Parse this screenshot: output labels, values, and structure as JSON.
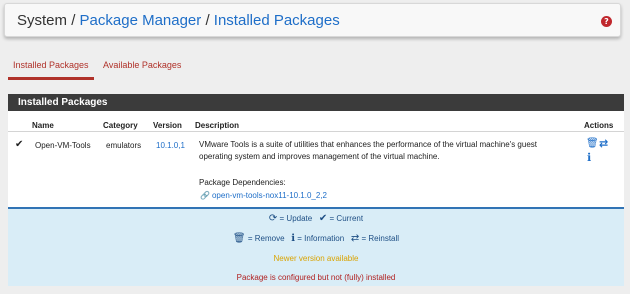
{
  "breadcrumb": {
    "root": "System",
    "sep1": "/",
    "pkgmgr": "Package Manager",
    "sep2": "/",
    "current": "Installed Packages",
    "help_glyph": "?"
  },
  "tabs": [
    {
      "label": "Installed Packages",
      "active": true
    },
    {
      "label": "Available Packages",
      "active": false
    }
  ],
  "panel": {
    "title": "Installed Packages",
    "columns": [
      "Name",
      "Category",
      "Version",
      "Description",
      "Actions"
    ],
    "rows": [
      {
        "status_icon": "check-icon",
        "status_glyph": "✔",
        "name": "Open-VM-Tools",
        "category": "emulators",
        "version": "10.1.0,1",
        "description": "VMware Tools is a suite of utilities that enhances the performance of the virtual machine's guest operating system and improves management of the virtual machine.",
        "dependencies_label": "Package Dependencies:",
        "dependency_glyph": "🔗",
        "dependency": "open-vm-tools-nox11-10.1.0_2,2",
        "actions": [
          {
            "icon": "trash-icon",
            "glyph": "🗑"
          },
          {
            "icon": "retweet-icon",
            "glyph": "⇄"
          },
          {
            "icon": "info-icon",
            "glyph": "ℹ"
          }
        ]
      }
    ]
  },
  "legend": {
    "update_glyph": "⟳",
    "update": "= Update",
    "current_glyph": "✔",
    "current": "= Current",
    "remove_glyph": "🗑",
    "remove": "= Remove",
    "info_glyph": "ℹ",
    "info": "= Information",
    "reinstall_glyph": "⇄",
    "reinstall": "= Reinstall",
    "newer": "Newer version available",
    "not_installed": "Package is configured but not (fully) installed"
  },
  "colors": {
    "accent": "#1e6ec8",
    "tab_active": "#b0322a",
    "panel_heading": "#3b3b3b",
    "legend_bg": "#d9edf7",
    "warning": "#d9a300",
    "danger": "#b02020"
  }
}
